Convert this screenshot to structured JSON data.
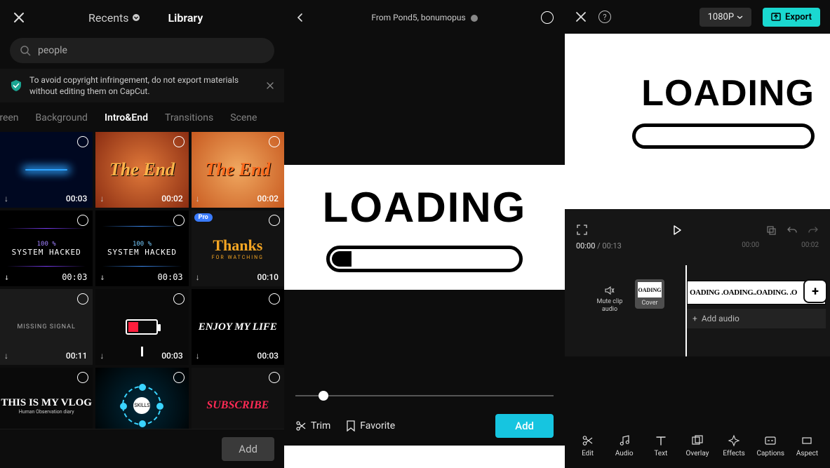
{
  "left": {
    "tabs": {
      "recents": "Recents",
      "library": "Library"
    },
    "search": {
      "placeholder": "people"
    },
    "notice": "To avoid copyright infringement, do not export materials without editing them on CapCut.",
    "categories": [
      "creen",
      "Background",
      "Intro&End",
      "Transitions",
      "Scene"
    ],
    "categories_active_index": 2,
    "clips": [
      {
        "dur": "00:03",
        "label": "",
        "style": "loading-blue"
      },
      {
        "dur": "00:02",
        "label": "The End",
        "style": "theend-bold"
      },
      {
        "dur": "00:02",
        "label": "The End",
        "style": "theend-light"
      },
      {
        "dur": "00:03",
        "label": "SYSTEM HACKED",
        "style": "hacked"
      },
      {
        "dur": "00:03",
        "label": "SYSTEM HACKED",
        "style": "hacked"
      },
      {
        "dur": "00:10",
        "label": "Thanks",
        "sub": "FOR WATCHING",
        "style": "thanks",
        "pro": "Pro"
      },
      {
        "dur": "00:11",
        "label": "MISSING SIGNAL",
        "style": "missing"
      },
      {
        "dur": "00:03",
        "label": "",
        "style": "battery"
      },
      {
        "dur": "00:03",
        "label": "ENJOY MY LIFE",
        "style": "enjoy"
      },
      {
        "dur": "",
        "label": "THIS IS MY VLOG",
        "sub": "Human Observation diary",
        "style": "vlog"
      },
      {
        "dur": "",
        "label": "SKILLS",
        "style": "skills"
      },
      {
        "dur": "",
        "label": "SUBSCRIBE",
        "style": "subscribe"
      }
    ],
    "add_label": "Add"
  },
  "mid": {
    "source": "From Pond5, bonumopus",
    "preview_word": "LOADING",
    "trim_label": "Trim",
    "favorite_label": "Favorite",
    "add_label": "Add"
  },
  "right": {
    "resolution": "1080P",
    "export_label": "Export",
    "preview_word": "LOADING",
    "time_current": "00:00",
    "time_total": "00:13",
    "ruler": [
      "00:00",
      "00:02"
    ],
    "mute_label": "Mute clip audio",
    "cover_label": "Cover",
    "cover_mini": "OADING",
    "clip_text": "OADING .OADING..OADING. .O",
    "add_audio_label": "Add audio",
    "tools": [
      {
        "id": "edit",
        "label": "Edit"
      },
      {
        "id": "audio",
        "label": "Audio"
      },
      {
        "id": "text",
        "label": "Text"
      },
      {
        "id": "overlay",
        "label": "Overlay"
      },
      {
        "id": "effects",
        "label": "Effects"
      },
      {
        "id": "captions",
        "label": "Captions"
      },
      {
        "id": "aspect",
        "label": "Aspect"
      }
    ]
  }
}
